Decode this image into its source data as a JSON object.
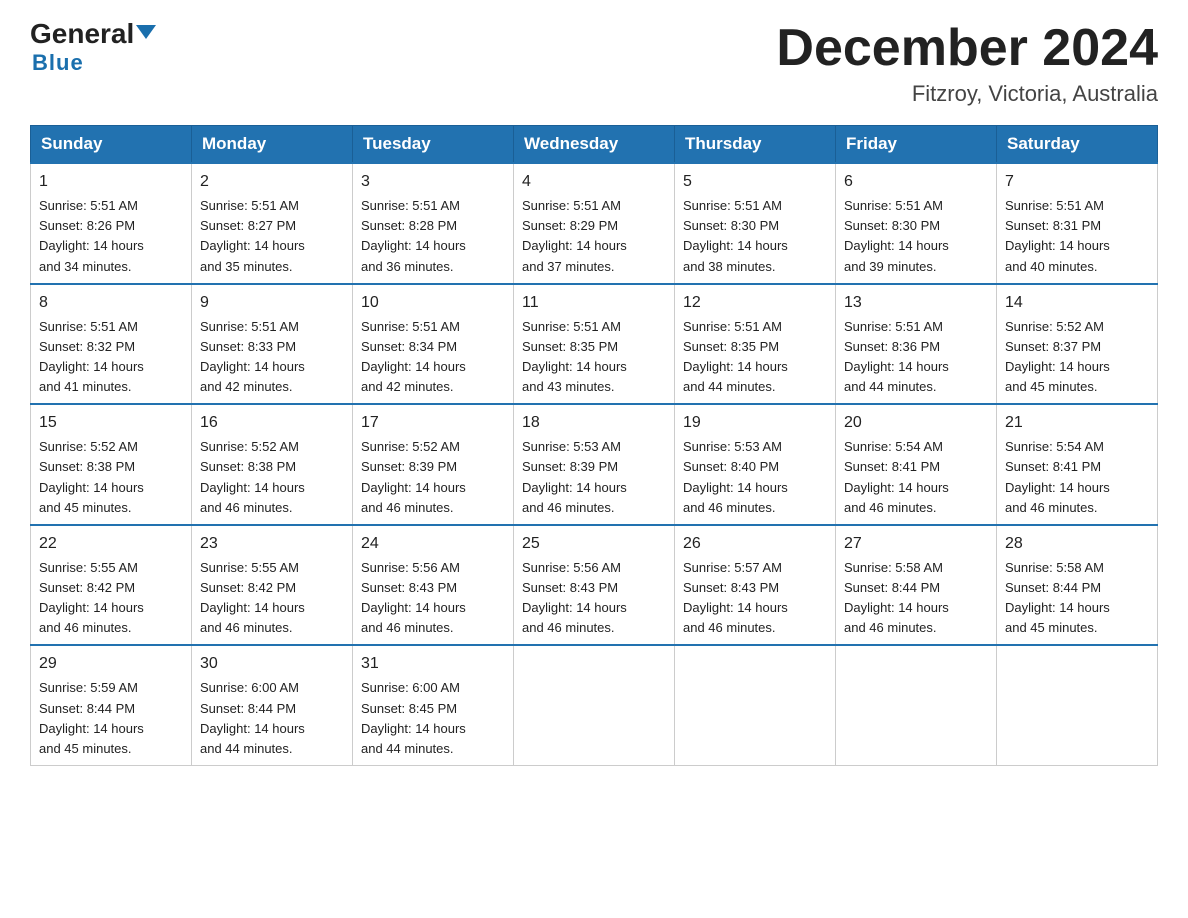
{
  "logo": {
    "line1_black": "General",
    "line1_blue_triangle": "▲",
    "line2": "Blue"
  },
  "title": {
    "month_year": "December 2024",
    "location": "Fitzroy, Victoria, Australia"
  },
  "days_of_week": [
    "Sunday",
    "Monday",
    "Tuesday",
    "Wednesday",
    "Thursday",
    "Friday",
    "Saturday"
  ],
  "weeks": [
    [
      {
        "day": "1",
        "sunrise": "5:51 AM",
        "sunset": "8:26 PM",
        "daylight": "14 hours and 34 minutes."
      },
      {
        "day": "2",
        "sunrise": "5:51 AM",
        "sunset": "8:27 PM",
        "daylight": "14 hours and 35 minutes."
      },
      {
        "day": "3",
        "sunrise": "5:51 AM",
        "sunset": "8:28 PM",
        "daylight": "14 hours and 36 minutes."
      },
      {
        "day": "4",
        "sunrise": "5:51 AM",
        "sunset": "8:29 PM",
        "daylight": "14 hours and 37 minutes."
      },
      {
        "day": "5",
        "sunrise": "5:51 AM",
        "sunset": "8:30 PM",
        "daylight": "14 hours and 38 minutes."
      },
      {
        "day": "6",
        "sunrise": "5:51 AM",
        "sunset": "8:30 PM",
        "daylight": "14 hours and 39 minutes."
      },
      {
        "day": "7",
        "sunrise": "5:51 AM",
        "sunset": "8:31 PM",
        "daylight": "14 hours and 40 minutes."
      }
    ],
    [
      {
        "day": "8",
        "sunrise": "5:51 AM",
        "sunset": "8:32 PM",
        "daylight": "14 hours and 41 minutes."
      },
      {
        "day": "9",
        "sunrise": "5:51 AM",
        "sunset": "8:33 PM",
        "daylight": "14 hours and 42 minutes."
      },
      {
        "day": "10",
        "sunrise": "5:51 AM",
        "sunset": "8:34 PM",
        "daylight": "14 hours and 42 minutes."
      },
      {
        "day": "11",
        "sunrise": "5:51 AM",
        "sunset": "8:35 PM",
        "daylight": "14 hours and 43 minutes."
      },
      {
        "day": "12",
        "sunrise": "5:51 AM",
        "sunset": "8:35 PM",
        "daylight": "14 hours and 44 minutes."
      },
      {
        "day": "13",
        "sunrise": "5:51 AM",
        "sunset": "8:36 PM",
        "daylight": "14 hours and 44 minutes."
      },
      {
        "day": "14",
        "sunrise": "5:52 AM",
        "sunset": "8:37 PM",
        "daylight": "14 hours and 45 minutes."
      }
    ],
    [
      {
        "day": "15",
        "sunrise": "5:52 AM",
        "sunset": "8:38 PM",
        "daylight": "14 hours and 45 minutes."
      },
      {
        "day": "16",
        "sunrise": "5:52 AM",
        "sunset": "8:38 PM",
        "daylight": "14 hours and 46 minutes."
      },
      {
        "day": "17",
        "sunrise": "5:52 AM",
        "sunset": "8:39 PM",
        "daylight": "14 hours and 46 minutes."
      },
      {
        "day": "18",
        "sunrise": "5:53 AM",
        "sunset": "8:39 PM",
        "daylight": "14 hours and 46 minutes."
      },
      {
        "day": "19",
        "sunrise": "5:53 AM",
        "sunset": "8:40 PM",
        "daylight": "14 hours and 46 minutes."
      },
      {
        "day": "20",
        "sunrise": "5:54 AM",
        "sunset": "8:41 PM",
        "daylight": "14 hours and 46 minutes."
      },
      {
        "day": "21",
        "sunrise": "5:54 AM",
        "sunset": "8:41 PM",
        "daylight": "14 hours and 46 minutes."
      }
    ],
    [
      {
        "day": "22",
        "sunrise": "5:55 AM",
        "sunset": "8:42 PM",
        "daylight": "14 hours and 46 minutes."
      },
      {
        "day": "23",
        "sunrise": "5:55 AM",
        "sunset": "8:42 PM",
        "daylight": "14 hours and 46 minutes."
      },
      {
        "day": "24",
        "sunrise": "5:56 AM",
        "sunset": "8:43 PM",
        "daylight": "14 hours and 46 minutes."
      },
      {
        "day": "25",
        "sunrise": "5:56 AM",
        "sunset": "8:43 PM",
        "daylight": "14 hours and 46 minutes."
      },
      {
        "day": "26",
        "sunrise": "5:57 AM",
        "sunset": "8:43 PM",
        "daylight": "14 hours and 46 minutes."
      },
      {
        "day": "27",
        "sunrise": "5:58 AM",
        "sunset": "8:44 PM",
        "daylight": "14 hours and 46 minutes."
      },
      {
        "day": "28",
        "sunrise": "5:58 AM",
        "sunset": "8:44 PM",
        "daylight": "14 hours and 45 minutes."
      }
    ],
    [
      {
        "day": "29",
        "sunrise": "5:59 AM",
        "sunset": "8:44 PM",
        "daylight": "14 hours and 45 minutes."
      },
      {
        "day": "30",
        "sunrise": "6:00 AM",
        "sunset": "8:44 PM",
        "daylight": "14 hours and 44 minutes."
      },
      {
        "day": "31",
        "sunrise": "6:00 AM",
        "sunset": "8:45 PM",
        "daylight": "14 hours and 44 minutes."
      },
      null,
      null,
      null,
      null
    ]
  ],
  "labels": {
    "sunrise": "Sunrise:",
    "sunset": "Sunset:",
    "daylight": "Daylight:"
  }
}
